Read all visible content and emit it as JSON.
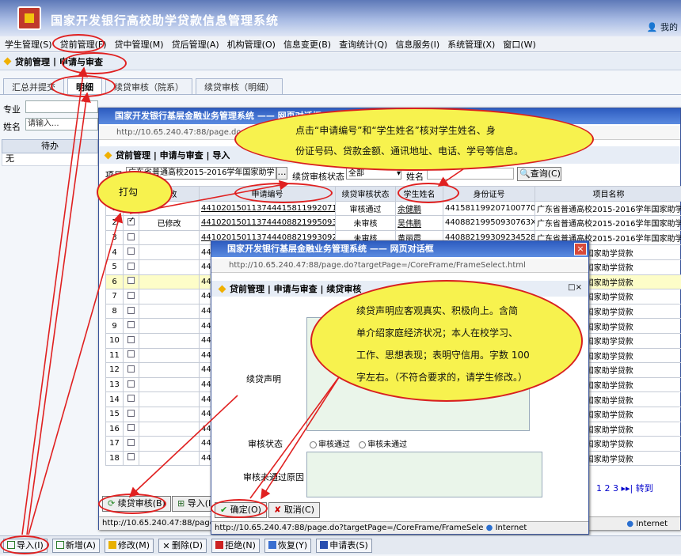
{
  "app": {
    "title": "国家开发银行高校助学贷款信息管理系统",
    "user_label": "我的"
  },
  "menu": [
    "学生管理(S)",
    "贷前管理(F)",
    "贷中管理(M)",
    "贷后管理(A)",
    "机构管理(O)",
    "信息变更(B)",
    "查询统计(Q)",
    "信息服务(I)",
    "系统管理(X)",
    "窗口(W)"
  ],
  "breadcrumb": {
    "section": "贷前管理",
    "page": "申请与审查"
  },
  "tabs": [
    "汇总并提交",
    "明细",
    "续贷审核（院系）",
    "续贷审核（明细）"
  ],
  "left_filters": {
    "major_label": "专业",
    "name_label": "姓名",
    "name_placeholder": "请输入...",
    "grid_header": "待办",
    "grid_value": "无"
  },
  "popup1": {
    "title": "国家开发银行基层金融业务管理系统 —— 网页对话框",
    "address": "http://10.65.240.47:88/page.do",
    "breadcrumb": "贷前管理 | 申请与审查 | 导入",
    "project_label": "项目",
    "project_value": "广东省普通高校2015-2016学年国家助学",
    "status_label": "续贷审核状态",
    "status_value": "全部",
    "name_label": "姓名",
    "query_label": "查询(C)",
    "columns": [
      "",
      "",
      "修改",
      "申请编号",
      "续贷审核状态",
      "学生姓名",
      "身份证号",
      "项目名称"
    ],
    "rows": [
      {
        "no": "1",
        "checked": false,
        "modified": "",
        "app_no": "44102015011374441581199207100770",
        "status": "审核通过",
        "name": "余健鹏",
        "id_no": "441581199207100770",
        "project": "广东省普通高校2015-2016学年国家助学贷款"
      },
      {
        "no": "2",
        "checked": true,
        "modified": "已修改",
        "app_no": "44102015011374440882199509307634",
        "status": "未审核",
        "name": "吴伟鹏",
        "id_no": "44088219950930763X",
        "project": "广东省普通高校2015-2016学年国家助学贷款"
      },
      {
        "no": "3",
        "checked": false,
        "modified": "",
        "app_no": "44102015011374440882199309234528",
        "status": "未审核",
        "name": "黄丽霞",
        "id_no": "440882199309234528",
        "project": "广东省普通高校2015-2016学年国家助学贷款"
      },
      {
        "no": "4",
        "checked": false,
        "modified": "",
        "app_no": "441",
        "status": "",
        "name": "",
        "id_no": "",
        "project": "15-2016学年国家助学贷款"
      },
      {
        "no": "5",
        "checked": false,
        "modified": "",
        "app_no": "441",
        "status": "",
        "name": "",
        "id_no": "",
        "project": "15-2016学年国家助学贷款"
      },
      {
        "no": "6",
        "checked": false,
        "modified": "",
        "app_no": "441",
        "status": "",
        "name": "",
        "id_no": "",
        "project": "15-2016学年国家助学贷款"
      },
      {
        "no": "7",
        "checked": false,
        "modified": "",
        "app_no": "441",
        "status": "",
        "name": "",
        "id_no": "",
        "project": "15-2016学年国家助学贷款"
      },
      {
        "no": "8",
        "checked": false,
        "modified": "",
        "app_no": "441",
        "status": "",
        "name": "",
        "id_no": "",
        "project": "15-2016学年国家助学贷款"
      },
      {
        "no": "9",
        "checked": false,
        "modified": "",
        "app_no": "441",
        "status": "",
        "name": "",
        "id_no": "",
        "project": "15-2016学年国家助学贷款"
      },
      {
        "no": "10",
        "checked": false,
        "modified": "",
        "app_no": "441",
        "status": "",
        "name": "",
        "id_no": "",
        "project": "15-2016学年国家助学贷款"
      },
      {
        "no": "11",
        "checked": false,
        "modified": "",
        "app_no": "441",
        "status": "",
        "name": "",
        "id_no": "",
        "project": "15-2016学年国家助学贷款"
      },
      {
        "no": "12",
        "checked": false,
        "modified": "",
        "app_no": "441",
        "status": "",
        "name": "",
        "id_no": "",
        "project": "15-2016学年国家助学贷款"
      },
      {
        "no": "13",
        "checked": false,
        "modified": "",
        "app_no": "441",
        "status": "",
        "name": "",
        "id_no": "",
        "project": "15-2016学年国家助学贷款"
      },
      {
        "no": "14",
        "checked": false,
        "modified": "",
        "app_no": "441",
        "status": "",
        "name": "",
        "id_no": "",
        "project": "15-2016学年国家助学贷款"
      },
      {
        "no": "15",
        "checked": false,
        "modified": "",
        "app_no": "441",
        "status": "",
        "name": "",
        "id_no": "",
        "project": "15-2016学年国家助学贷款"
      },
      {
        "no": "16",
        "checked": false,
        "modified": "",
        "app_no": "441",
        "status": "",
        "name": "",
        "id_no": "",
        "project": "15-2016学年国家助学贷款"
      },
      {
        "no": "17",
        "checked": false,
        "modified": "",
        "app_no": "441",
        "status": "",
        "name": "",
        "id_no": "",
        "project": "15-2016学年国家助学贷款"
      },
      {
        "no": "18",
        "checked": false,
        "modified": "",
        "app_no": "441",
        "status": "",
        "name": "",
        "id_no": "",
        "project": "15-2016学年国家助学贷款"
      }
    ],
    "pager": "1  2  3  ▸▸|  转到",
    "review_button": "续贷审核(B)",
    "import_button": "导入(I)",
    "status_url": "http://10.65.240.47:88/page",
    "zone": "Internet"
  },
  "popup2": {
    "title": "国家开发银行基层金融业务管理系统 —— 网页对话框",
    "close": "×",
    "address": "http://10.65.240.47:88/page.do?targetPage=/CoreFrame/FrameSelect.html",
    "breadcrumb": "贷前管理 | 申请与审查 | 续贷审核",
    "statement_label": "续贷声明",
    "review_label": "审核状态",
    "radio_pass": "审核通过",
    "radio_fail": "审核未通过",
    "reason_label": "审核未通过原因",
    "ok_button": "确定(O)",
    "cancel_button": "取消(C)",
    "status_url": "http://10.65.240.47:88/page.do?targetPage=/CoreFrame/FrameSele",
    "zone": "Internet"
  },
  "bottom_toolbar": [
    "导入(I)",
    "新增(A)",
    "修改(M)",
    "删除(D)",
    "拒绝(N)",
    "恢复(Y)",
    "申请表(S)"
  ],
  "annotations": {
    "check_note": "打勾",
    "verify_note_line1": "点击“申请编号”和“学生姓名”核对学生姓名、身",
    "verify_note_line2": "份证号码、贷款金额、通讯地址、电话、学号等信息。",
    "statement_note_line1": "续贷声明应客观真实、积极向上。含简",
    "statement_note_line2": "单介绍家庭经济状况；本人在校学习、",
    "statement_note_line3": "工作、思想表现；表明守信用。字数 100",
    "statement_note_line4": "字左右。（不符合要求的，请学生修改。）"
  },
  "colors": {
    "accent": "#2d5cc0",
    "annotation_fill": "#f7f24e",
    "annotation_stroke": "#e02020",
    "row_highlight": "#fdfdc8"
  }
}
